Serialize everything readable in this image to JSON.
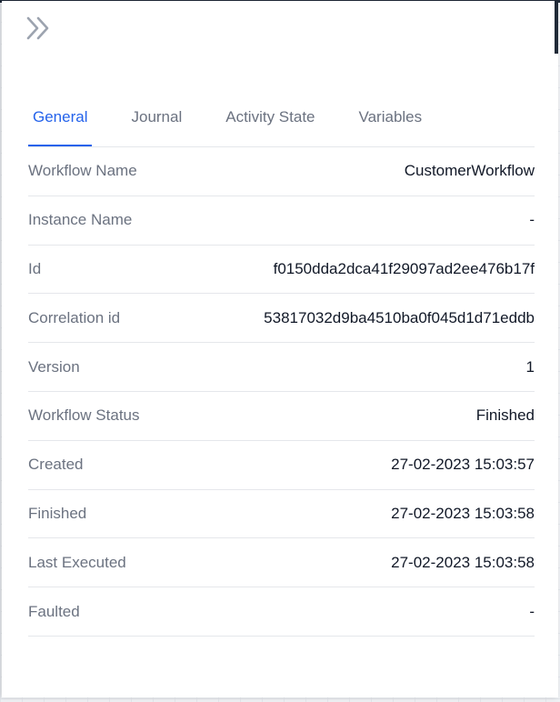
{
  "panel": {
    "collapse_icon": "chevron-double-right-icon"
  },
  "tabs": [
    {
      "label": "General",
      "active": true
    },
    {
      "label": "Journal",
      "active": false
    },
    {
      "label": "Activity State",
      "active": false
    },
    {
      "label": "Variables",
      "active": false
    }
  ],
  "general": {
    "rows": [
      {
        "label": "Workflow Name",
        "value": "CustomerWorkflow"
      },
      {
        "label": "Instance Name",
        "value": "-"
      },
      {
        "label": "Id",
        "value": "f0150dda2dca41f29097ad2ee476b17f"
      },
      {
        "label": "Correlation id",
        "value": "53817032d9ba4510ba0f045d1d71eddb"
      },
      {
        "label": "Version",
        "value": "1"
      },
      {
        "label": "Workflow Status",
        "value": "Finished"
      },
      {
        "label": "Created",
        "value": "27-02-2023 15:03:57"
      },
      {
        "label": "Finished",
        "value": "27-02-2023 15:03:58"
      },
      {
        "label": "Last Executed",
        "value": "27-02-2023 15:03:58"
      },
      {
        "label": "Faulted",
        "value": "-"
      }
    ]
  },
  "colors": {
    "accent": "#2563eb",
    "label": "#6b7280",
    "value": "#111827",
    "divider": "#e5e7eb"
  }
}
